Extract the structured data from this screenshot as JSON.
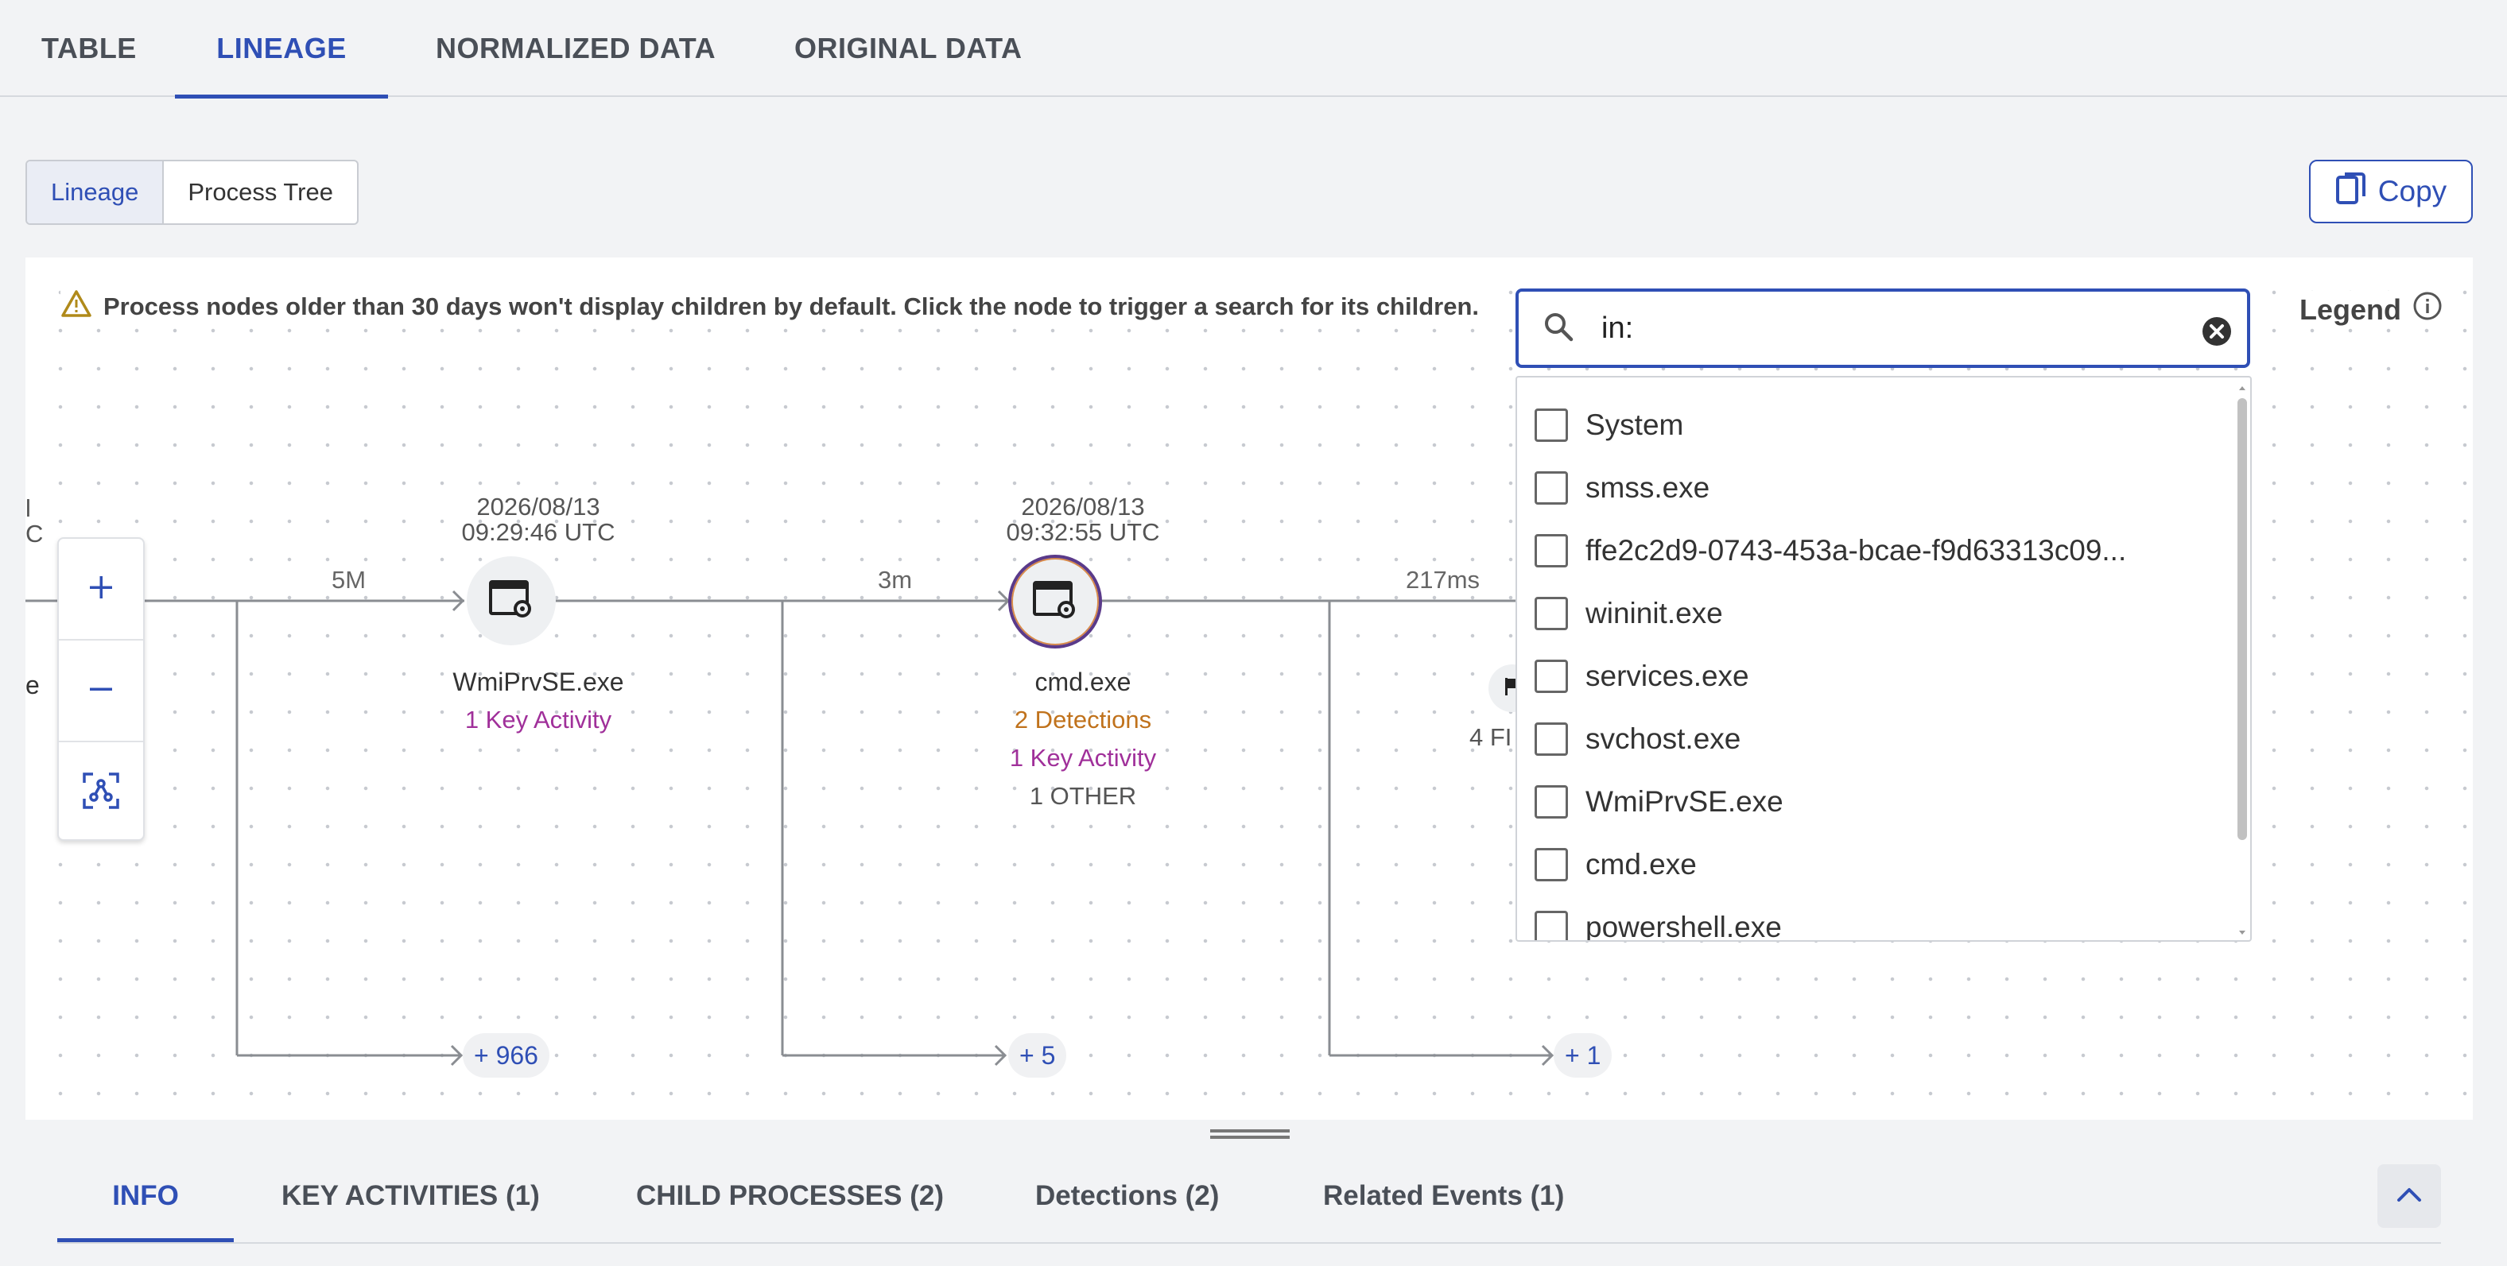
{
  "top_tabs": [
    "TABLE",
    "LINEAGE",
    "NORMALIZED DATA",
    "ORIGINAL DATA"
  ],
  "view_toggle": {
    "lineage": "Lineage",
    "process_tree": "Process Tree"
  },
  "copy_label": "Copy",
  "warning_text": "Process nodes older than 30 days won't display children by default. Click the node to trigger a search for its children.",
  "legend_label": "Legend",
  "search": {
    "value": "in:"
  },
  "dropdown_options": [
    "System",
    "smss.exe",
    "ffe2c2d9-0743-453a-bcae-f9d63313c09...",
    "wininit.exe",
    "services.exe",
    "svchost.exe",
    "WmiPrvSE.exe",
    "cmd.exe",
    "powershell.exe"
  ],
  "graph": {
    "left_partial": {
      "line1": "l",
      "line2": "C",
      "name": "e"
    },
    "edges": [
      "5M",
      "3m",
      "217ms"
    ],
    "nodes": [
      {
        "date": "2026/08/13",
        "time": "09:29:46 UTC",
        "name": "WmiPrvSE.exe",
        "key_activity": "1 Key Activity"
      },
      {
        "date": "2026/08/13",
        "time": "09:32:55 UTC",
        "name": "cmd.exe",
        "detections": "2 Detections",
        "key_activity": "1 Key Activity",
        "other": "1 OTHER"
      }
    ],
    "partial_node_label": "4 FI",
    "more_children": [
      "+ 966",
      "+ 5",
      "+ 1"
    ]
  },
  "bottom_tabs": [
    "INFO",
    "KEY ACTIVITIES (1)",
    "CHILD PROCESSES (2)",
    "Detections (2)",
    "Related Events (1)"
  ],
  "colors": {
    "accent": "#2f4fb5",
    "key_activity": "#a0309a",
    "detections": "#c0721c"
  }
}
